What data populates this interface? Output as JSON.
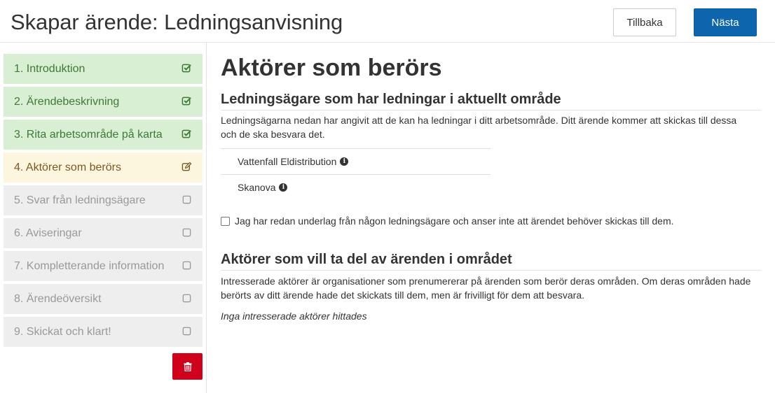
{
  "header": {
    "title": "Skapar ärende: Ledningsanvisning",
    "back_label": "Tillbaka",
    "next_label": "Nästa"
  },
  "sidebar": {
    "steps": [
      {
        "label": "1. Introduktion",
        "status": "done",
        "icon": "check-square-icon"
      },
      {
        "label": "2. Ärendebeskrivning",
        "status": "done",
        "icon": "check-square-icon"
      },
      {
        "label": "3. Rita arbetsområde på karta",
        "status": "done",
        "icon": "check-square-icon"
      },
      {
        "label": "4. Aktörer som berörs",
        "status": "current",
        "icon": "edit-icon"
      },
      {
        "label": "5. Svar från ledningsägare",
        "status": "todo",
        "icon": "empty-square-icon"
      },
      {
        "label": "6. Aviseringar",
        "status": "todo",
        "icon": "empty-square-icon"
      },
      {
        "label": "7. Kompletterande information",
        "status": "todo",
        "icon": "empty-square-icon"
      },
      {
        "label": "8. Ärendeöversikt",
        "status": "todo",
        "icon": "empty-square-icon"
      },
      {
        "label": "9. Skickat och klart!",
        "status": "todo",
        "icon": "empty-square-icon"
      }
    ],
    "delete_icon": "trash-icon"
  },
  "main": {
    "heading": "Aktörer som berörs",
    "owners_section": {
      "heading": "Ledningsägare som har ledningar i aktuellt område",
      "description": "Ledningsägarna nedan har angivit att de kan ha ledningar i ditt arbetsområde. Ditt ärende kommer att skickas till dessa och de ska besvara det.",
      "owners": [
        "Vattenfall Eldistribution",
        "Skanova"
      ],
      "checkbox_label": "Jag har redan underlag från någon ledningsägare och anser inte att ärendet behöver skickas till dem."
    },
    "interested_section": {
      "heading": "Aktörer som vill ta del av ärenden i området",
      "description": "Intresserade aktörer är organisationer som prenumererar på ärenden som berör deras områden. Om deras områden hade berörts av ditt ärende hade det skickats till dem, men är frivilligt för dem att besvara.",
      "empty_message": "Inga intresserade aktörer hittades"
    }
  },
  "colors": {
    "primary": "#0c65ad",
    "done_bg": "#d9efd4",
    "done_text": "#3c7a35",
    "current_bg": "#fbf6dd",
    "current_text": "#7a5a23",
    "todo_bg": "#eeeeee",
    "todo_text": "#999999",
    "danger": "#d0021b"
  }
}
